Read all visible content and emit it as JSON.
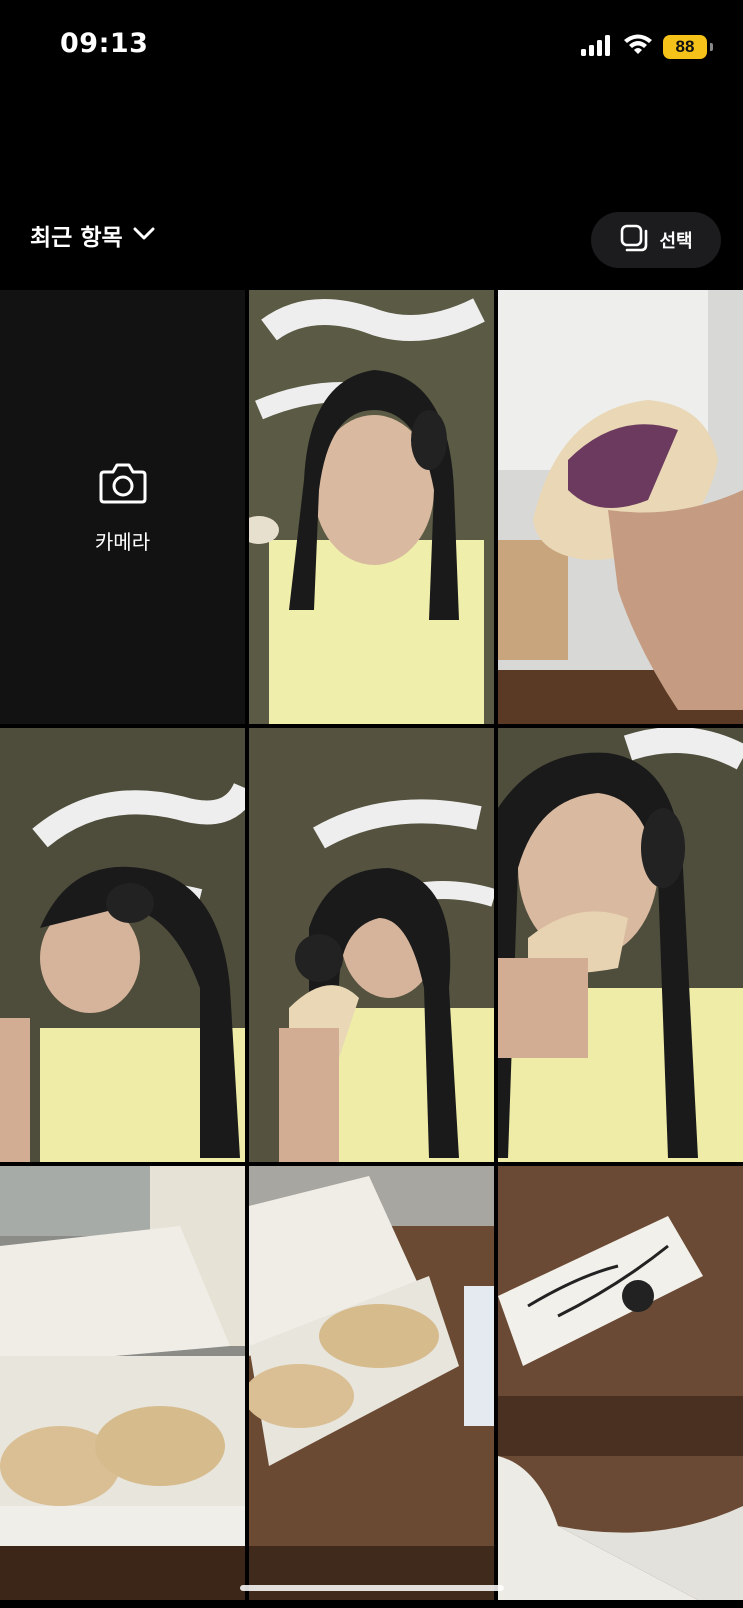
{
  "status_bar": {
    "time": "09:13",
    "battery_level": "88",
    "signal_icon": "cellular-signal-icon",
    "wifi_icon": "wifi-icon"
  },
  "header": {
    "album_title": "최근 항목",
    "album_dropdown_icon": "chevron-down-icon",
    "select_label": "선택",
    "select_icon": "select-multiple-icon"
  },
  "grid": {
    "camera_label": "카메라",
    "camera_icon": "camera-icon",
    "photos": [
      {
        "description": "woman with headphones, cafe sign behind"
      },
      {
        "description": "sandwich held in hand"
      },
      {
        "description": "woman eating, eyes closed"
      },
      {
        "description": "woman holding sandwich looking up"
      },
      {
        "description": "woman biting sandwich"
      },
      {
        "description": "sandwiches in paper box"
      },
      {
        "description": "sandwich box on wooden table"
      },
      {
        "description": "box with handwritten note"
      }
    ]
  },
  "colors": {
    "background": "#000000",
    "camera_tile": "#121212",
    "select_button_bg": "#1c1c1e",
    "battery": "#f5c21a"
  }
}
